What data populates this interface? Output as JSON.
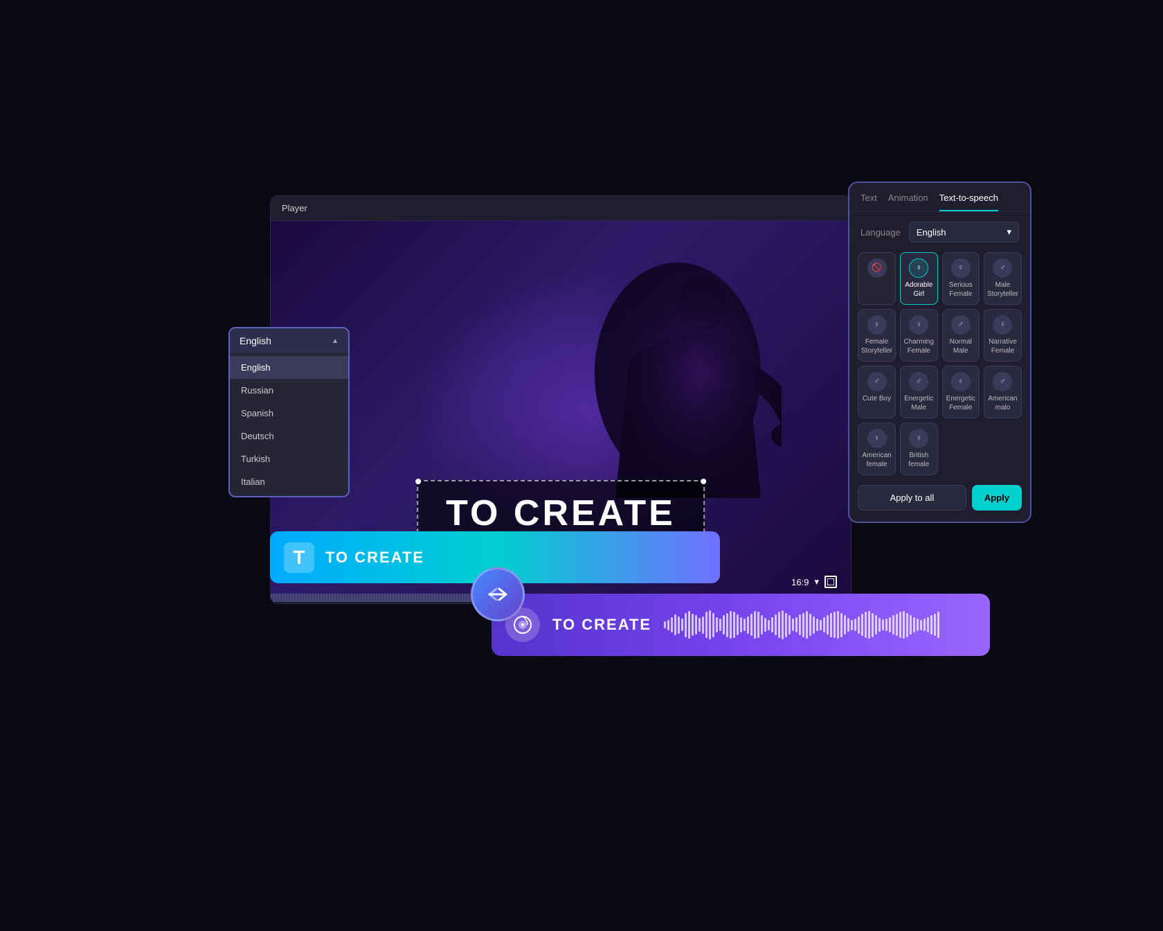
{
  "player": {
    "title": "Player",
    "ratio": "16:9",
    "main_text": "TO CREATE"
  },
  "language_dropdown": {
    "selected": "English",
    "options": [
      "English",
      "Russian",
      "Spanish",
      "Deutsch",
      "Turkish",
      "Italian"
    ]
  },
  "tts_panel": {
    "tabs": [
      "Text",
      "Animation",
      "Text-to-speech"
    ],
    "active_tab": "Text-to-speech",
    "language_label": "Language",
    "language_value": "English",
    "voices": [
      {
        "id": "muted",
        "name": "",
        "lines": [],
        "muted": true
      },
      {
        "id": "adorable-girl",
        "name": "Adorable Girl",
        "selected": true
      },
      {
        "id": "serious-female",
        "name": "Serious Female"
      },
      {
        "id": "male-storyteller",
        "name": "Male Storyteller"
      },
      {
        "id": "female-storyteller",
        "name": "Female Storyteller"
      },
      {
        "id": "charming-female",
        "name": "Charming Female"
      },
      {
        "id": "normal-male",
        "name": "Normal Male"
      },
      {
        "id": "narrative-female",
        "name": "Narrative Female"
      },
      {
        "id": "cute-boy",
        "name": "Cute Boy"
      },
      {
        "id": "energetic-male",
        "name": "Energetic Male"
      },
      {
        "id": "energetic-female",
        "name": "Energetic Female"
      },
      {
        "id": "american-malo",
        "name": "American malo"
      },
      {
        "id": "american-female",
        "name": "American female"
      },
      {
        "id": "british-female",
        "name": "British female"
      }
    ],
    "apply_all_label": "Apply to all",
    "apply_label": "Apply"
  },
  "text_track": {
    "icon": "T",
    "label": "TO CREATE"
  },
  "audio_track": {
    "label": "TO CREATE"
  }
}
